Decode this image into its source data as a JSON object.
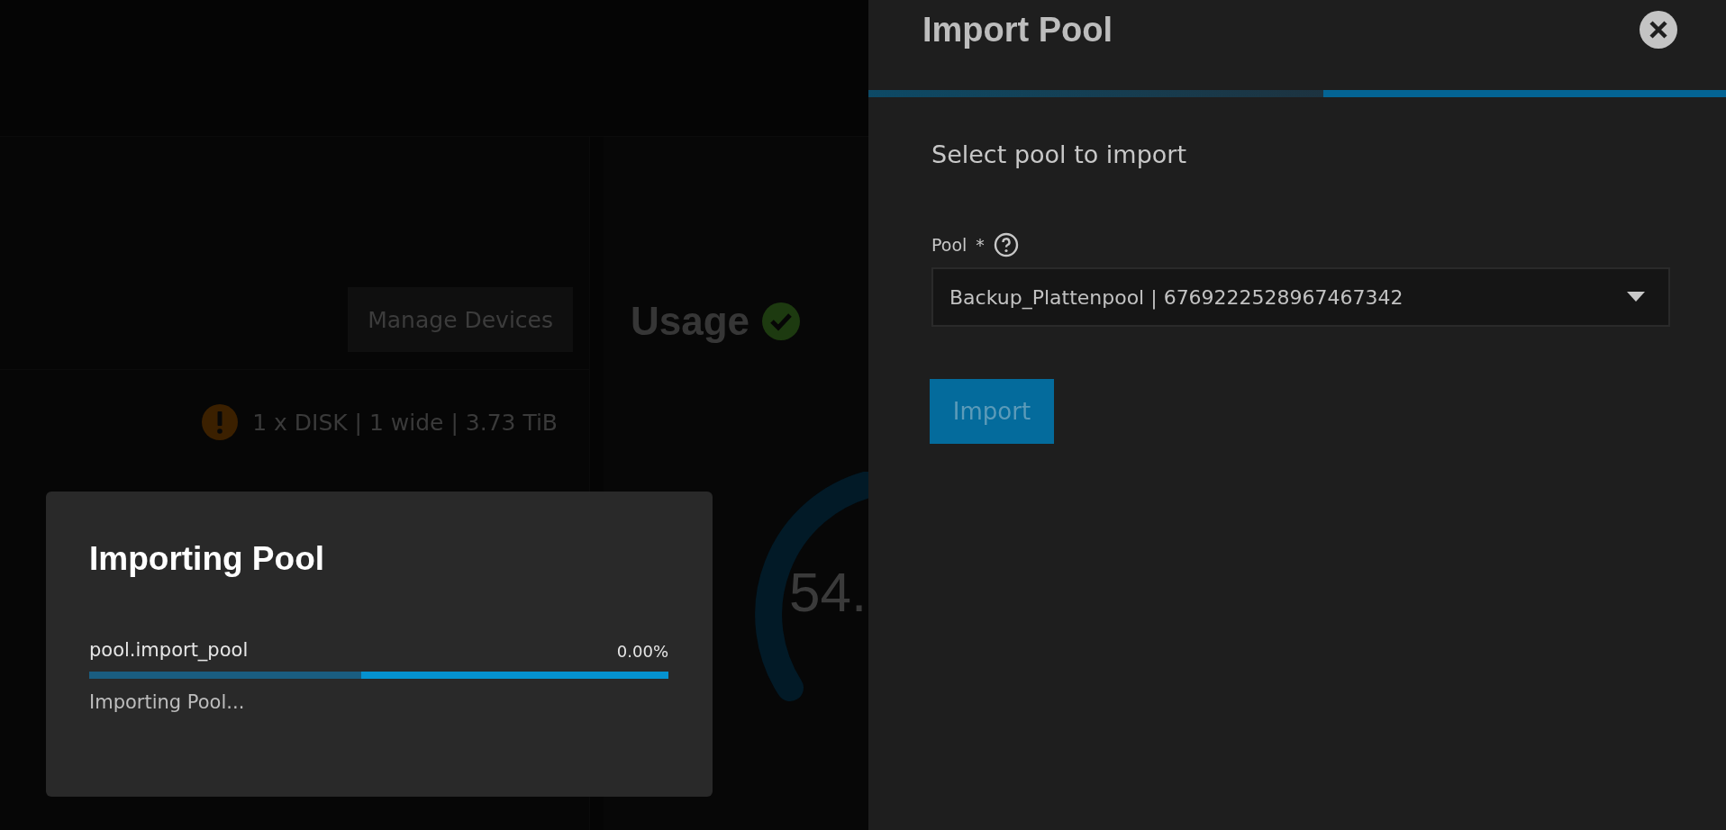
{
  "background": {
    "manage_button": "Manage Devices",
    "usage_card": {
      "title": "Usage",
      "healthy": true,
      "gauge_value": "54."
    },
    "vdev_summary": {
      "warning": true,
      "text": "1 x DISK | 1 wide | 3.73 TiB"
    }
  },
  "side_panel": {
    "title": "Import Pool",
    "progress": {
      "level": 0.53
    },
    "heading": "Select pool to import",
    "field": {
      "label": "Pool",
      "required_mark": "*",
      "value": "Backup_Plattenpool | 6769222528967467342"
    },
    "button": {
      "label": "Import",
      "disabled": true
    }
  },
  "job_dialog": {
    "title": "Importing Pool",
    "job_name": "pool.import_pool",
    "level": 0.47,
    "percent": "0.00%",
    "status": "Importing Pool..."
  }
}
